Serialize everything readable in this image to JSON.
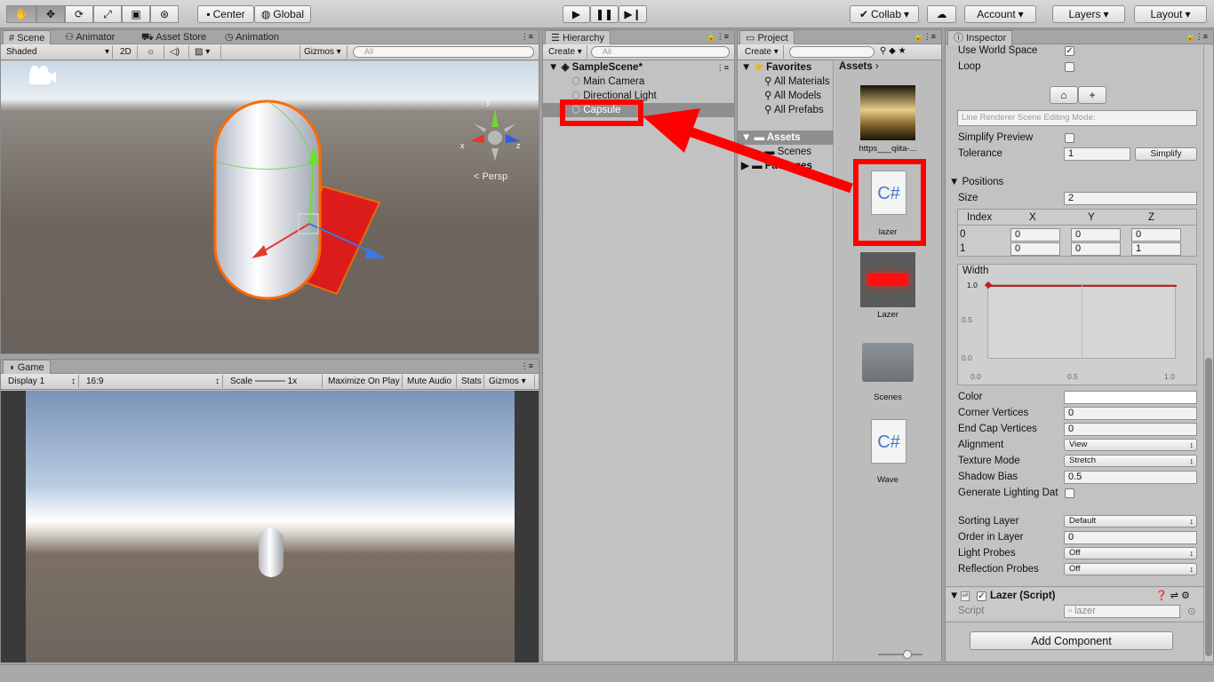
{
  "toolbar": {
    "tools": [
      "hand-icon",
      "move-icon",
      "rotate-icon",
      "scale-icon",
      "rect-icon",
      "transform-icon"
    ],
    "pivot": "Center",
    "space": "Global",
    "collab": "Collab",
    "account": "Account",
    "layers": "Layers",
    "layout": "Layout"
  },
  "scene": {
    "tabs": [
      "Scene",
      "Animator",
      "Asset Store",
      "Animation"
    ],
    "shading": "Shaded",
    "mode2d": "2D",
    "gizmos": "Gizmos",
    "search_placeholder": "All",
    "persp": "Persp",
    "axis_x": "x",
    "axis_y": "y",
    "axis_z": "z"
  },
  "game": {
    "tab": "Game",
    "display": "Display 1",
    "aspect": "16:9",
    "scale_label": "Scale",
    "scale_value": "1x",
    "maximize": "Maximize On Play",
    "mute": "Mute Audio",
    "stats": "Stats",
    "gizmos": "Gizmos"
  },
  "hierarchy": {
    "tab": "Hierarchy",
    "create": "Create",
    "search_placeholder": "All",
    "scene": "SampleScene*",
    "items": [
      "Main Camera",
      "Directional Light",
      "Capsule"
    ]
  },
  "project": {
    "tab": "Project",
    "create": "Create",
    "favorites": "Favorites",
    "fav_items": [
      "All Materials",
      "All Models",
      "All Prefabs"
    ],
    "assets_root": "Assets",
    "assets_children": [
      "Scenes",
      "Packages"
    ],
    "breadcrumb": "Assets",
    "assets": [
      {
        "name": "https___qiita-...",
        "kind": "texture"
      },
      {
        "name": "lazer",
        "kind": "script"
      },
      {
        "name": "Lazer",
        "kind": "material"
      },
      {
        "name": "Scenes",
        "kind": "folder"
      },
      {
        "name": "Wave",
        "kind": "script"
      }
    ],
    "script_glyph": "C#"
  },
  "inspector": {
    "tab": "Inspector",
    "use_world_space": "Use World Space",
    "use_world_space_checked": true,
    "loop": "Loop",
    "loop_checked": false,
    "edit_mode_placeholder": "Line Renderer Scene Editing Mode:",
    "simplify_preview": "Simplify Preview",
    "tolerance": "Tolerance",
    "tolerance_value": "1",
    "simplify_btn": "Simplify",
    "positions": "Positions",
    "size": "Size",
    "size_value": "2",
    "pos_headers": [
      "Index",
      "X",
      "Y",
      "Z"
    ],
    "pos_rows": [
      [
        "0",
        "0",
        "0",
        "0"
      ],
      [
        "1",
        "0",
        "0",
        "1"
      ]
    ],
    "width": "Width",
    "width_curve_value": "1.0",
    "width_y_ticks": [
      "0.5",
      "0.0"
    ],
    "width_x_ticks": [
      "0.0",
      "0.5",
      "1.0"
    ],
    "color": "Color",
    "corner_vertices": "Corner Vertices",
    "corner_value": "0",
    "end_cap_vertices": "End Cap Vertices",
    "end_cap_value": "0",
    "alignment": "Alignment",
    "alignment_value": "View",
    "texture_mode": "Texture Mode",
    "texture_mode_value": "Stretch",
    "shadow_bias": "Shadow Bias",
    "shadow_bias_value": "0.5",
    "generate_lighting": "Generate Lighting Dat",
    "sorting_layer": "Sorting Layer",
    "sorting_layer_value": "Default",
    "order_in_layer": "Order in Layer",
    "order_value": "0",
    "light_probes": "Light Probes",
    "light_probes_value": "Off",
    "reflection_probes": "Reflection Probes",
    "reflection_probes_value": "Off",
    "component_title": "Lazer (Script)",
    "script_label": "Script",
    "script_value": "lazer",
    "add_component": "Add Component"
  },
  "colors": {
    "highlight_red": "#ff0000",
    "selection_orange": "#ff6a00"
  }
}
